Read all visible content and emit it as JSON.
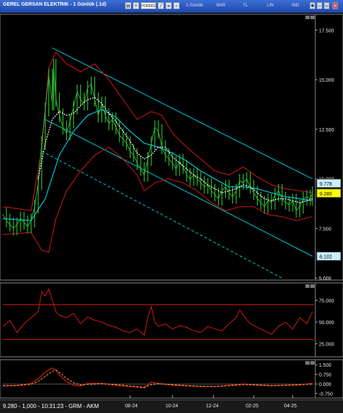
{
  "window": {
    "title": "GEREL GERSAN ELEKTRIK - 1 Günlük (.1d)",
    "toolbar": {
      "forex_label": "FOREKS",
      "period_label": "1 Günlük",
      "type_label": "BAR",
      "currency_label": "TL",
      "scale_label": "LIN",
      "indicator_label": "IND"
    }
  },
  "status": {
    "text": "9.280 - 1,000 - 10:31:23 - GRM - AKM"
  },
  "colors": {
    "background": "#000000",
    "channel": "#00c8d4",
    "bollinger": "#d01818",
    "price": "#2fb52f",
    "moving_average": "#ffffff",
    "rsi": "#d01818",
    "oscillator": "#d01818",
    "last_price_tag": "#ffff00",
    "info_tag": "#cceeff"
  },
  "chart_data": [
    {
      "type": "line",
      "name": "price",
      "y_ticks": [
        "17.500",
        "15.000",
        "12.500",
        "10.000",
        "7.500",
        "5.000"
      ],
      "ylim": [
        4.9,
        18.3
      ],
      "x_ticks": [
        "08-24",
        "10-24",
        "12-24",
        "02-25",
        "04-25"
      ],
      "price_tags": [
        {
          "label": "9.778",
          "value": 9.778,
          "style": "info"
        },
        {
          "label": "9.280",
          "value": 9.28,
          "style": "last"
        },
        {
          "label": "6.102",
          "value": 6.102,
          "style": "info"
        }
      ],
      "price_series": [
        [
          0,
          8.2
        ],
        [
          5,
          7.9
        ],
        [
          10,
          7.7
        ],
        [
          15,
          7.5
        ],
        [
          20,
          7.7
        ],
        [
          25,
          8.0
        ],
        [
          30,
          7.8
        ],
        [
          35,
          7.6
        ],
        [
          40,
          7.9
        ],
        [
          45,
          8.6
        ],
        [
          50,
          9.8
        ],
        [
          55,
          11.8
        ],
        [
          60,
          13.5
        ],
        [
          65,
          15.2
        ],
        [
          70,
          13.8
        ],
        [
          72,
          15.7
        ],
        [
          75,
          14.0
        ],
        [
          80,
          13.2
        ],
        [
          85,
          12.6
        ],
        [
          90,
          12.3
        ],
        [
          95,
          12.9
        ],
        [
          100,
          13.6
        ],
        [
          105,
          14.4
        ],
        [
          110,
          14.0
        ],
        [
          115,
          13.8
        ],
        [
          120,
          14.6
        ],
        [
          125,
          14.8
        ],
        [
          130,
          14.0
        ],
        [
          135,
          13.2
        ],
        [
          140,
          13.8
        ],
        [
          145,
          13.2
        ],
        [
          150,
          12.8
        ],
        [
          155,
          13.0
        ],
        [
          160,
          12.6
        ],
        [
          165,
          12.2
        ],
        [
          170,
          12.0
        ],
        [
          175,
          11.8
        ],
        [
          180,
          11.4
        ],
        [
          185,
          11.2
        ],
        [
          190,
          10.8
        ],
        [
          195,
          10.5
        ],
        [
          200,
          10.2
        ],
        [
          205,
          11.0
        ],
        [
          210,
          11.8
        ],
        [
          215,
          12.6
        ],
        [
          220,
          12.4
        ],
        [
          225,
          11.6
        ],
        [
          230,
          11.2
        ],
        [
          235,
          11.0
        ],
        [
          240,
          10.8
        ],
        [
          245,
          10.5
        ],
        [
          250,
          10.9
        ],
        [
          255,
          10.6
        ],
        [
          260,
          10.2
        ],
        [
          265,
          10.0
        ],
        [
          270,
          10.2
        ],
        [
          275,
          10.0
        ],
        [
          280,
          9.8
        ],
        [
          285,
          9.6
        ],
        [
          290,
          9.7
        ],
        [
          295,
          9.4
        ],
        [
          300,
          9.2
        ],
        [
          305,
          9.0
        ],
        [
          310,
          9.4
        ],
        [
          315,
          9.6
        ],
        [
          320,
          9.3
        ],
        [
          325,
          9.1
        ],
        [
          330,
          9.4
        ],
        [
          335,
          9.9
        ],
        [
          340,
          9.8
        ],
        [
          345,
          10.0
        ],
        [
          350,
          9.6
        ],
        [
          355,
          9.3
        ],
        [
          360,
          9.0
        ],
        [
          365,
          8.8
        ],
        [
          370,
          8.6
        ],
        [
          375,
          8.9
        ],
        [
          380,
          8.8
        ],
        [
          385,
          9.2
        ],
        [
          390,
          9.4
        ],
        [
          395,
          9.0
        ],
        [
          400,
          8.8
        ],
        [
          405,
          8.7
        ],
        [
          410,
          8.9
        ],
        [
          415,
          8.4
        ],
        [
          420,
          8.6
        ],
        [
          425,
          9.0
        ],
        [
          430,
          9.1
        ],
        [
          435,
          9.0
        ],
        [
          438,
          9.28
        ]
      ],
      "ma_series": [
        [
          50,
          10.0
        ],
        [
          60,
          11.8
        ],
        [
          70,
          13.0
        ],
        [
          80,
          13.4
        ],
        [
          90,
          13.2
        ],
        [
          100,
          13.3
        ],
        [
          110,
          13.7
        ],
        [
          120,
          14.0
        ],
        [
          130,
          14.1
        ],
        [
          140,
          13.8
        ],
        [
          150,
          13.3
        ],
        [
          160,
          12.9
        ],
        [
          170,
          12.4
        ],
        [
          180,
          11.9
        ],
        [
          190,
          11.3
        ],
        [
          200,
          11.0
        ],
        [
          210,
          11.2
        ],
        [
          220,
          11.6
        ],
        [
          230,
          11.6
        ],
        [
          240,
          11.1
        ],
        [
          250,
          10.8
        ],
        [
          260,
          10.5
        ],
        [
          270,
          10.2
        ],
        [
          280,
          10.0
        ],
        [
          290,
          9.7
        ],
        [
          300,
          9.5
        ],
        [
          310,
          9.3
        ],
        [
          320,
          9.4
        ],
        [
          330,
          9.5
        ],
        [
          340,
          9.7
        ],
        [
          350,
          9.6
        ],
        [
          360,
          9.3
        ],
        [
          370,
          9.0
        ],
        [
          380,
          8.9
        ],
        [
          390,
          9.0
        ],
        [
          400,
          9.0
        ],
        [
          410,
          8.9
        ],
        [
          420,
          8.8
        ],
        [
          430,
          8.9
        ],
        [
          438,
          9.0
        ]
      ],
      "mid_series": [
        [
          0,
          8.0
        ],
        [
          40,
          7.9
        ],
        [
          60,
          9.0
        ],
        [
          80,
          11.2
        ],
        [
          100,
          12.4
        ],
        [
          120,
          13.2
        ],
        [
          140,
          13.5
        ],
        [
          160,
          13.1
        ],
        [
          180,
          12.4
        ],
        [
          200,
          11.8
        ],
        [
          220,
          11.6
        ],
        [
          240,
          11.3
        ],
        [
          260,
          10.9
        ],
        [
          280,
          10.4
        ],
        [
          300,
          10.0
        ],
        [
          320,
          9.6
        ],
        [
          340,
          9.6
        ],
        [
          360,
          9.5
        ],
        [
          380,
          9.3
        ],
        [
          400,
          9.1
        ],
        [
          420,
          9.0
        ],
        [
          438,
          8.9
        ]
      ],
      "upper_band": [
        [
          0,
          8.6
        ],
        [
          40,
          8.4
        ],
        [
          55,
          11.5
        ],
        [
          65,
          15.6
        ],
        [
          75,
          16.4
        ],
        [
          90,
          15.8
        ],
        [
          110,
          15.4
        ],
        [
          130,
          15.8
        ],
        [
          150,
          15.0
        ],
        [
          170,
          14.0
        ],
        [
          190,
          13.0
        ],
        [
          210,
          13.4
        ],
        [
          225,
          13.2
        ],
        [
          240,
          12.3
        ],
        [
          260,
          11.6
        ],
        [
          280,
          11.0
        ],
        [
          300,
          10.4
        ],
        [
          320,
          10.2
        ],
        [
          340,
          10.6
        ],
        [
          360,
          10.1
        ],
        [
          380,
          9.7
        ],
        [
          400,
          9.5
        ],
        [
          420,
          9.4
        ],
        [
          438,
          9.3
        ]
      ],
      "lower_band": [
        [
          0,
          7.2
        ],
        [
          40,
          7.3
        ],
        [
          55,
          6.4
        ],
        [
          65,
          6.3
        ],
        [
          75,
          8.0
        ],
        [
          90,
          9.4
        ],
        [
          110,
          10.4
        ],
        [
          130,
          11.2
        ],
        [
          150,
          11.6
        ],
        [
          170,
          11.0
        ],
        [
          190,
          10.2
        ],
        [
          200,
          9.4
        ],
        [
          215,
          9.8
        ],
        [
          235,
          10.0
        ],
        [
          255,
          9.8
        ],
        [
          275,
          9.4
        ],
        [
          295,
          8.8
        ],
        [
          315,
          8.4
        ],
        [
          335,
          8.6
        ],
        [
          355,
          8.6
        ],
        [
          375,
          8.2
        ],
        [
          395,
          8.1
        ],
        [
          415,
          7.9
        ],
        [
          438,
          8.1
        ]
      ],
      "channel_upper": [
        [
          70,
          16.6
        ],
        [
          438,
          10.0
        ]
      ],
      "channel_lower": [
        [
          60,
          13.0
        ],
        [
          438,
          6.1
        ]
      ],
      "channel_dashed": [
        [
          55,
          11.4
        ],
        [
          395,
          5.0
        ]
      ]
    },
    {
      "type": "line",
      "name": "rsi",
      "y_ticks": [
        "75.000",
        "50.000",
        "25.000"
      ],
      "ylim": [
        10,
        95
      ],
      "levels": [
        70,
        30
      ],
      "x": [
        0,
        10,
        20,
        30,
        40,
        50,
        55,
        60,
        65,
        70,
        75,
        80,
        90,
        100,
        110,
        120,
        130,
        140,
        150,
        160,
        170,
        180,
        190,
        200,
        205,
        210,
        215,
        220,
        230,
        240,
        250,
        260,
        270,
        280,
        290,
        300,
        310,
        320,
        330,
        335,
        340,
        350,
        360,
        370,
        380,
        390,
        400,
        410,
        420,
        430,
        438
      ],
      "values": [
        45,
        52,
        38,
        48,
        55,
        62,
        85,
        80,
        88,
        75,
        62,
        58,
        55,
        60,
        48,
        56,
        52,
        50,
        46,
        44,
        40,
        38,
        42,
        35,
        55,
        68,
        50,
        45,
        48,
        42,
        46,
        44,
        40,
        38,
        45,
        42,
        40,
        48,
        55,
        64,
        58,
        48,
        44,
        40,
        36,
        45,
        50,
        42,
        55,
        48,
        62
      ]
    },
    {
      "type": "line",
      "name": "oscillator",
      "y_ticks": [
        "1.500",
        "0.750",
        "0.000",
        "-0.750"
      ],
      "ylim": [
        -1.1,
        1.9
      ],
      "levels": [
        0
      ],
      "x": [
        0,
        20,
        40,
        50,
        60,
        70,
        75,
        80,
        90,
        100,
        110,
        120,
        140,
        160,
        180,
        200,
        210,
        220,
        240,
        260,
        280,
        300,
        320,
        340,
        360,
        380,
        400,
        420,
        438
      ],
      "values": [
        -0.15,
        -0.12,
        0.05,
        0.4,
        0.95,
        1.25,
        1.1,
        0.7,
        0.2,
        -0.1,
        -0.15,
        0.05,
        0.05,
        -0.1,
        -0.2,
        -0.3,
        0.15,
        0.05,
        -0.1,
        -0.15,
        -0.2,
        -0.2,
        -0.1,
        0.0,
        -0.1,
        -0.15,
        -0.1,
        -0.05,
        0.05
      ],
      "signal_values": [
        -0.12,
        -0.13,
        -0.02,
        0.2,
        0.6,
        1.0,
        1.08,
        0.9,
        0.45,
        0.1,
        -0.08,
        -0.04,
        0.02,
        -0.05,
        -0.15,
        -0.25,
        -0.05,
        0.02,
        -0.05,
        -0.12,
        -0.17,
        -0.2,
        -0.14,
        -0.05,
        -0.07,
        -0.12,
        -0.11,
        -0.07,
        0.0
      ]
    }
  ]
}
